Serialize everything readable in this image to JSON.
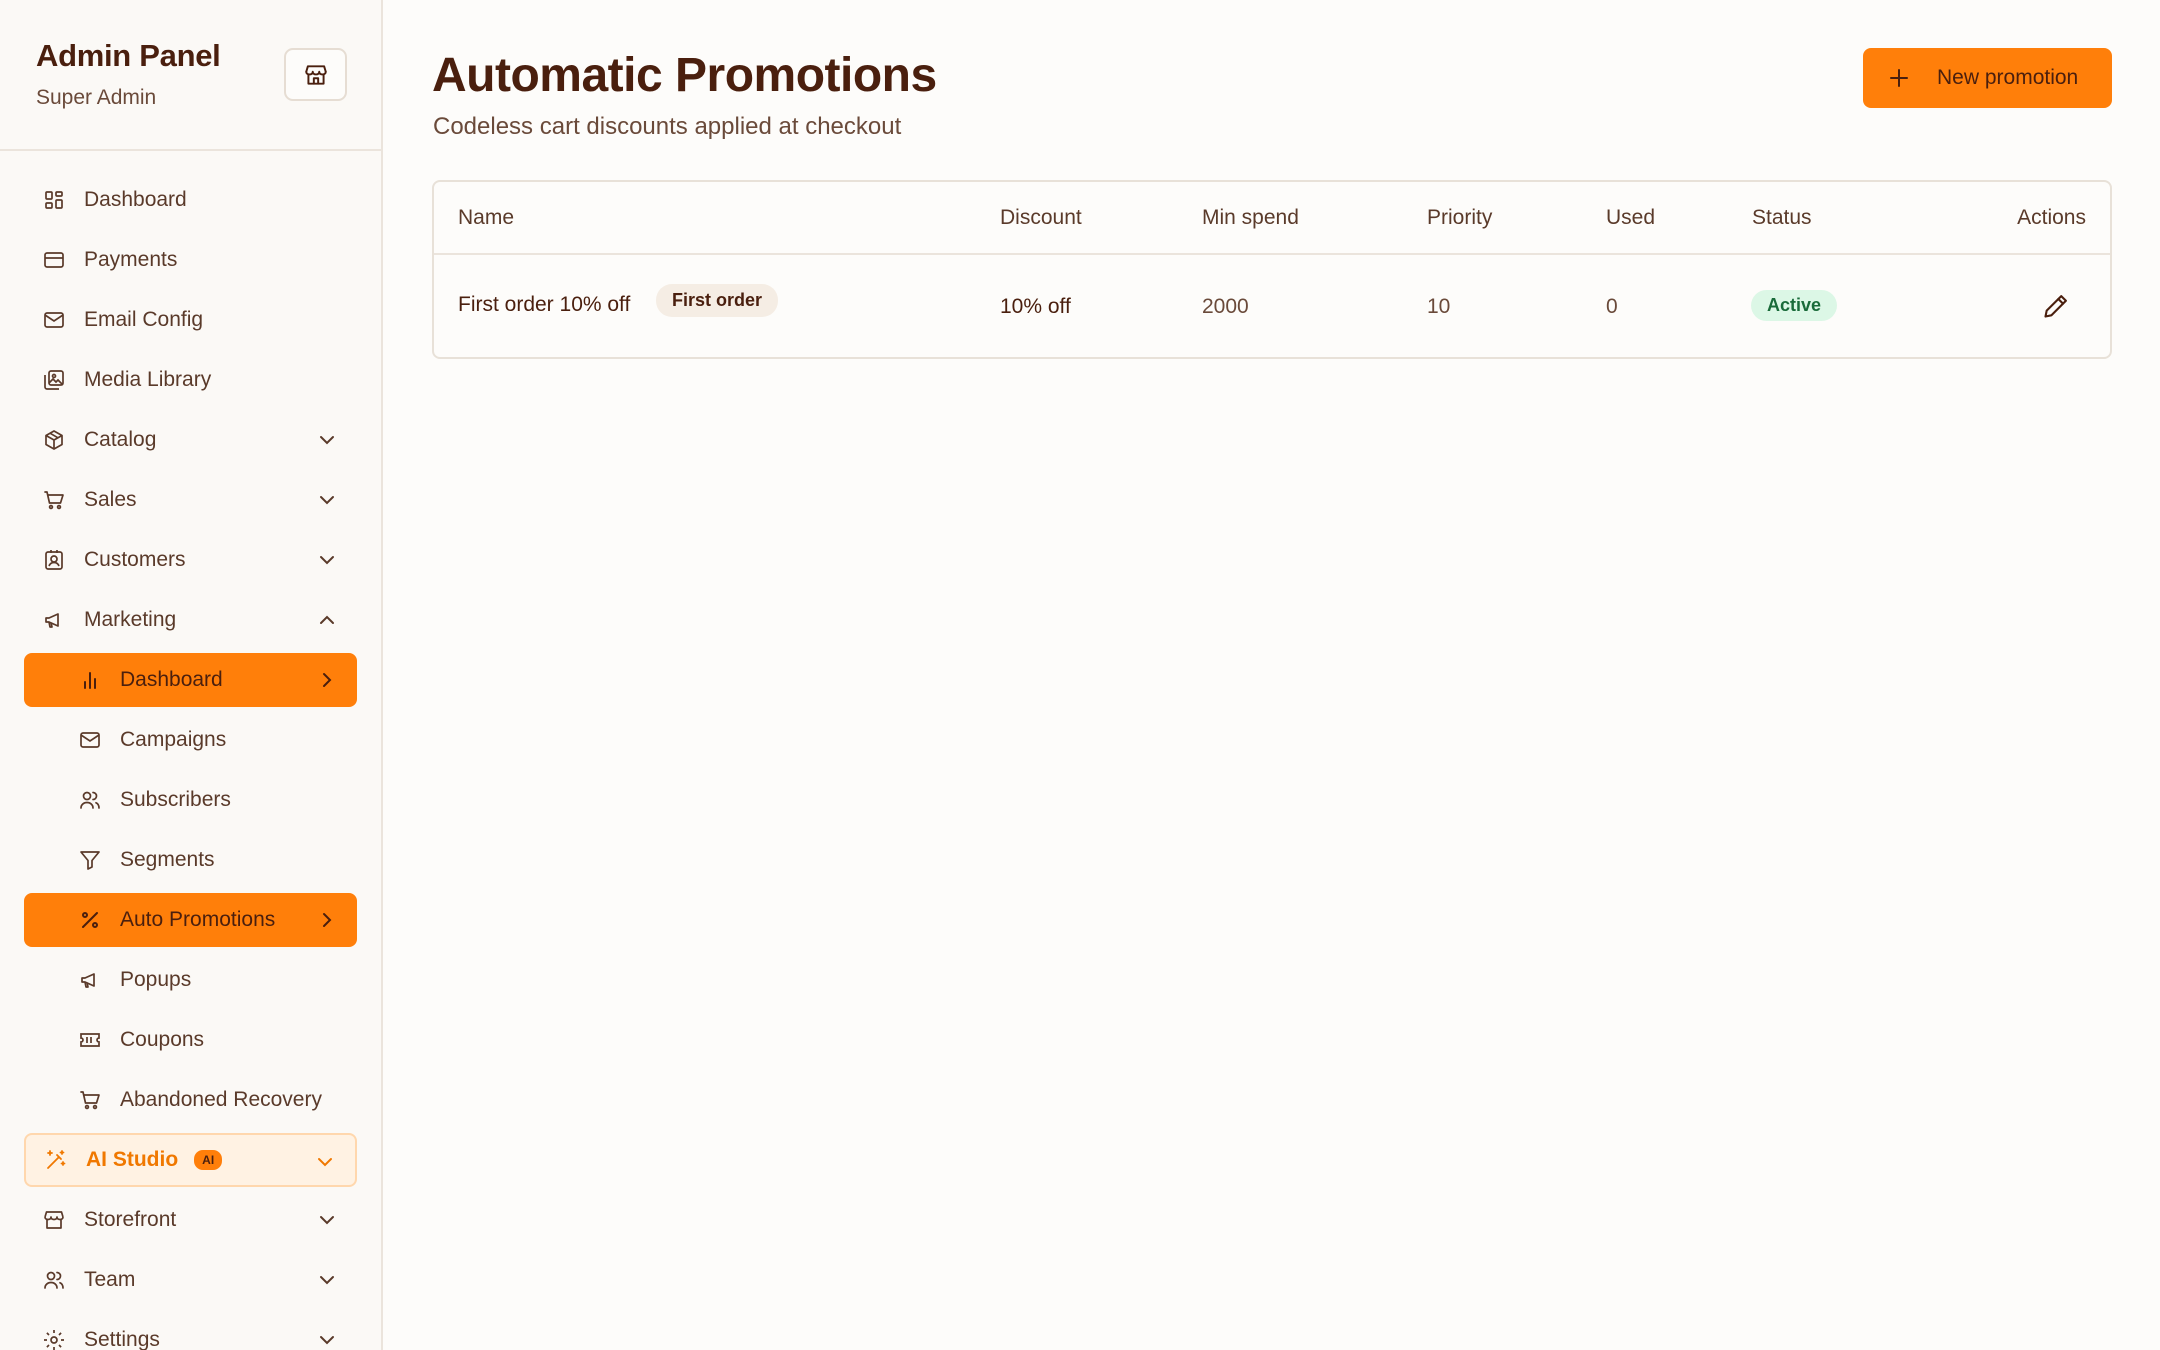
{
  "sidebar": {
    "title": "Admin Panel",
    "subtitle": "Super Admin",
    "nav": [
      {
        "label": "Dashboard",
        "icon": "grid-icon"
      },
      {
        "label": "Payments",
        "icon": "card-icon"
      },
      {
        "label": "Email Config",
        "icon": "mail-icon"
      },
      {
        "label": "Media Library",
        "icon": "image-icon"
      },
      {
        "label": "Catalog",
        "icon": "box-icon"
      },
      {
        "label": "Sales",
        "icon": "cart-icon"
      },
      {
        "label": "Customers",
        "icon": "contact-icon"
      },
      {
        "label": "Marketing",
        "icon": "megaphone-icon"
      },
      {
        "label": "Dashboard",
        "icon": "bar-chart-icon"
      },
      {
        "label": "Campaigns",
        "icon": "mail-icon"
      },
      {
        "label": "Subscribers",
        "icon": "users-icon"
      },
      {
        "label": "Segments",
        "icon": "filter-icon"
      },
      {
        "label": "Auto Promotions",
        "icon": "percent-icon"
      },
      {
        "label": "Popups",
        "icon": "megaphone-icon"
      },
      {
        "label": "Coupons",
        "icon": "ticket-icon"
      },
      {
        "label": "Abandoned Recovery",
        "icon": "cart-icon"
      },
      {
        "label": "AI Studio",
        "icon": "wand-icon",
        "badge": "AI"
      },
      {
        "label": "Storefront",
        "icon": "store-icon"
      },
      {
        "label": "Team",
        "icon": "users-icon"
      },
      {
        "label": "Settings",
        "icon": "gear-icon"
      }
    ]
  },
  "header": {
    "title": "Automatic Promotions",
    "subtitle": "Codeless cart discounts applied at checkout",
    "new_button": "New promotion"
  },
  "table": {
    "columns": [
      "Name",
      "Discount",
      "Min spend",
      "Priority",
      "Used",
      "Status",
      "Actions"
    ],
    "rows": [
      {
        "name": "First order 10% off",
        "tag": "First order",
        "discount": "10% off",
        "min_spend": "2000",
        "priority": "10",
        "used": "0",
        "status": "Active"
      }
    ]
  },
  "colors": {
    "accent": "#ff7f0a",
    "title": "#4a1f0e",
    "status_active_bg": "#dcf7e6",
    "status_active_text": "#1a6b3a"
  }
}
